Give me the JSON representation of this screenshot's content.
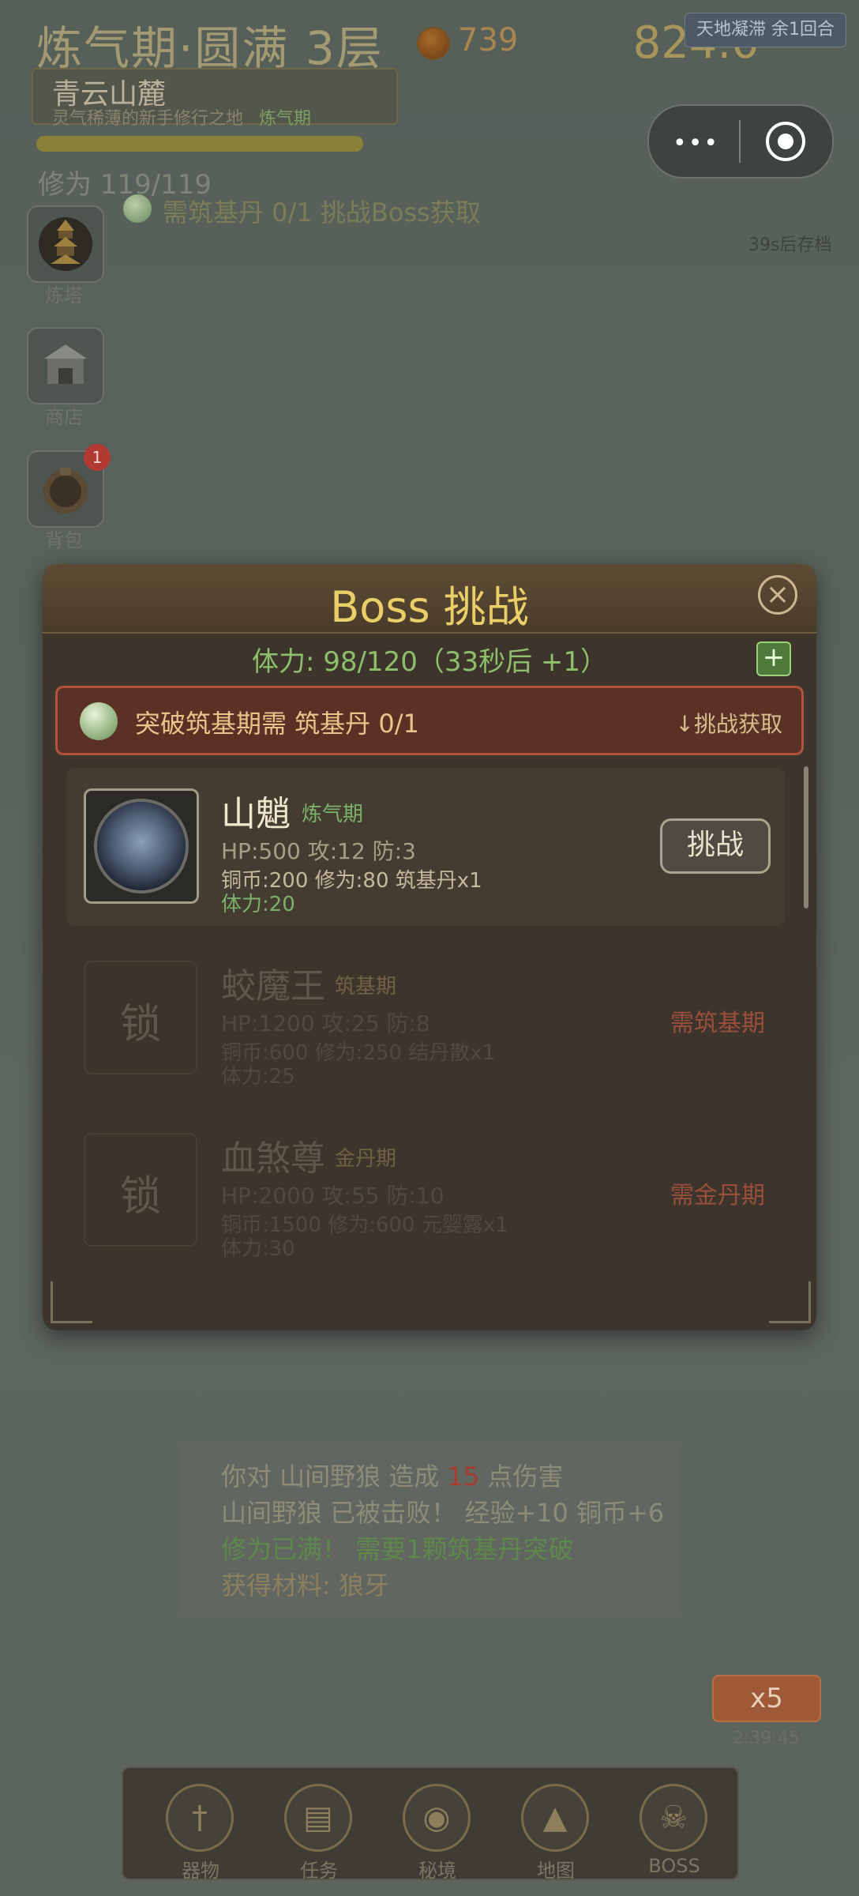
{
  "hud": {
    "realm": "炼气期·圆满 3层",
    "coins": "739",
    "right_value": "824.0",
    "event_badge": "天地凝滞 余1回合",
    "location_name": "青云山麓",
    "location_desc": "灵气稀薄的新手修行之地",
    "location_tier": "炼气期",
    "cultivation": "修为 119/119",
    "hint": "需筑基丹 0/1 挑战Boss获取",
    "autosave": "39s后存档"
  },
  "side_buttons": [
    {
      "label": "炼塔",
      "icon": "pagoda-icon"
    },
    {
      "label": "商店",
      "icon": "shop-icon"
    },
    {
      "label": "背包",
      "icon": "bag-icon",
      "badge": "1"
    }
  ],
  "modal": {
    "title": "Boss 挑战",
    "close_icon": "close-icon",
    "stamina": "体力: 98/120（33秒后 +1）",
    "plus": "+",
    "notice_text": "突破筑基期需 筑基丹 0/1",
    "notice_link": "↓挑战获取",
    "bosses": [
      {
        "name": "山魈",
        "tier": "炼气期",
        "stats": "HP:500  攻:12  防:3",
        "rewards": "铜币:200 修为:80  筑基丹x1",
        "stamina": "体力:20",
        "action": "挑战",
        "locked": false
      },
      {
        "name": "蛟魔王",
        "tier": "筑基期",
        "stats": "HP:1200  攻:25  防:8",
        "rewards": "铜币:600 修为:250  结丹散x1",
        "stamina": "体力:25",
        "lock": "锁",
        "requirement": "需筑基期",
        "locked": true
      },
      {
        "name": "血煞尊",
        "tier": "金丹期",
        "stats": "HP:2000  攻:55  防:10",
        "rewards": "铜币:1500 修为:600  元婴露x1",
        "stamina": "体力:30",
        "lock": "锁",
        "requirement": "需金丹期",
        "locked": true
      }
    ]
  },
  "battle_log": {
    "line1_prefix": "你对 山间野狼 造成 ",
    "line1_damage": "15",
    "line1_suffix": " 点伤害",
    "line2": "山间野狼 已被击败！ 经验+10 铜币+6",
    "line3": "修为已满！ 需要1颗筑基丹突破",
    "line4": "获得材料: 狼牙"
  },
  "speed": {
    "label": "x5",
    "time": "2:39:45"
  },
  "bottom_nav": [
    {
      "label": "器物",
      "icon": "sword-icon",
      "glyph": "†"
    },
    {
      "label": "任务",
      "icon": "scroll-icon",
      "glyph": "▤"
    },
    {
      "label": "秘境",
      "icon": "portal-icon",
      "glyph": "◉"
    },
    {
      "label": "地图",
      "icon": "mountain-icon",
      "glyph": "▲"
    },
    {
      "label": "BOSS",
      "icon": "skull-icon",
      "glyph": "☠"
    }
  ],
  "colors": {
    "modal_bg": "#3d352b",
    "title_gold": "#e8cf68",
    "stamina_green": "#8dbf6c",
    "notice_border": "#b3523e",
    "locked_red": "#9a4f3c"
  }
}
